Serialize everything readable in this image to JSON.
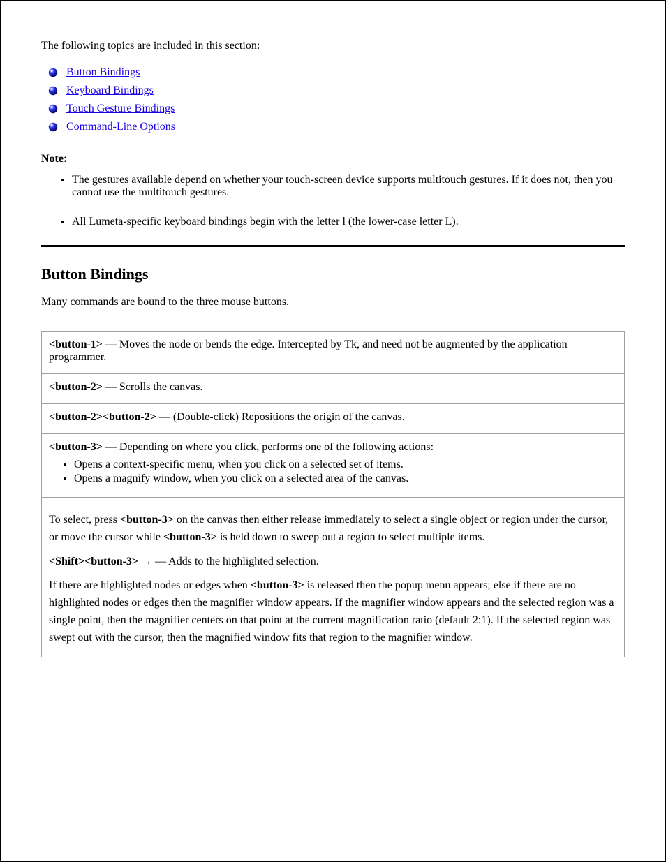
{
  "intro": "The following topics are included in this section:",
  "topics": [
    "Button Bindings",
    "Keyboard Bindings",
    "Touch Gesture Bindings",
    "Command-Line Options"
  ],
  "note_label": "Note:",
  "notes": [
    "The gestures available depend on whether your touch-screen device supports multitouch gestures. If it does not, then you cannot use the multitouch gestures.",
    "All Lumeta-specific keyboard bindings begin with the letter l (the lower-case letter L)."
  ],
  "section_title": "Button Bindings",
  "section_desc": "Many commands are bound to the three mouse buttons.",
  "table": {
    "r0": {
      "cmd": "<button-1>",
      "desc": "Moves the node or bends the edge. Intercepted by Tk, and need not be augmented by the application programmer."
    },
    "r1": {
      "cmd": "<button-2>",
      "desc": "Scrolls the canvas."
    },
    "r2": {
      "cmd": "<button-2><button-2>",
      "desc": "(Double-click) Repositions the origin of the canvas."
    },
    "r3": {
      "cmd": "<button-3>",
      "desc_pre": "Depending on where you click, performs one of the following actions:",
      "b1": "Opens a context-specific menu, when you click on a selected set of items.",
      "b2": "Opens a magnify window, when you click on a selected area of the canvas."
    },
    "r4": {
      "p1_a": "To select, press ",
      "p1_b": "<button-3>",
      "p1_c": " on the canvas then either release immediately to select a single object or region under the cursor, or move the cursor while ",
      "p1_d": "<button-3>",
      "p1_e": " is held down to sweep out a region to select multiple items.",
      "p2_a": "<Shift><button-3>",
      "p2_b": " — Adds to the highlighted selection.",
      "p3_a": "If there are highlighted nodes or edges when ",
      "p3_b": "<button-3>",
      "p3_c": " is released then the popup menu appears; else if there are no highlighted nodes or edges then the magnifier window appears. If the magnifier window appears and the selected region was a single point, then the magnifier centers on that point at the current magnification ratio (default 2:1). If the selected region was swept out with the cursor, then the magnified window fits that region to the magnifier window."
    }
  }
}
